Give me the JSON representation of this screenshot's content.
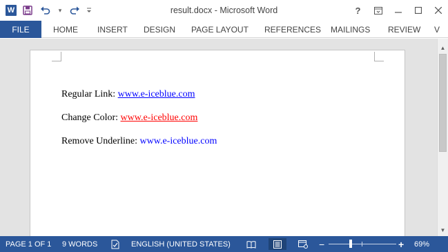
{
  "window": {
    "title": "result.docx - Microsoft Word",
    "app_icon_letter": "W",
    "quick_access": [
      "save-icon",
      "undo-icon",
      "redo-icon",
      "customize-qat-icon"
    ],
    "controls": {
      "help": "?",
      "ribbon_display": "ribbon-display-options-icon",
      "minimize": "minimize-icon",
      "maximize": "maximize-icon",
      "close": "close-icon"
    }
  },
  "ribbon": {
    "file_tab": "FILE",
    "tabs": [
      "HOME",
      "INSERT",
      "DESIGN",
      "PAGE LAYOUT",
      "REFERENCES",
      "MAILINGS",
      "REVIEW",
      "V"
    ]
  },
  "document": {
    "paragraphs": [
      {
        "label": "Regular Link: ",
        "link": "www.e-iceblue.com",
        "style": "regular",
        "link_color": "#0000ff",
        "underline": true
      },
      {
        "label": "Change Color: ",
        "link": "www.e-iceblue.com",
        "style": "red",
        "link_color": "#ff0000",
        "underline": true
      },
      {
        "label": "Remove Underline: ",
        "link": "www.e-iceblue.com",
        "style": "plain",
        "link_color": "#0000ff",
        "underline": false
      }
    ]
  },
  "status_bar": {
    "page": "PAGE 1 OF 1",
    "words": "9 WORDS",
    "proofing_icon": "proofing-icon",
    "language": "ENGLISH (UNITED STATES)",
    "views": [
      "read-mode-icon",
      "print-layout-icon",
      "web-layout-icon"
    ],
    "active_view": "print-layout-icon",
    "zoom_out": "−",
    "zoom_in": "+",
    "zoom_level": "69%"
  },
  "colors": {
    "accent": "#2b579a",
    "document_background": "#e3e3e3"
  }
}
